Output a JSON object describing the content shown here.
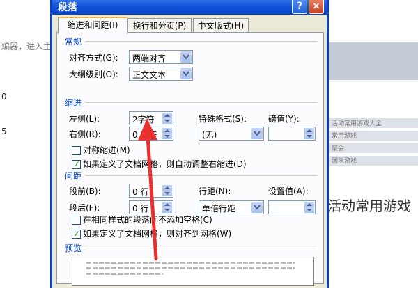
{
  "background": {
    "left_text": "編器，进入主",
    "right_title": "活动常用游戏",
    "right_items": [
      "活动常用游戏大全",
      "常用游戏",
      "聚会",
      "团队游戏"
    ]
  },
  "dialog": {
    "title": "段落",
    "help_label": "?",
    "close_label": "×",
    "tabs": [
      {
        "label": "缩进和间距(I)",
        "active": true
      },
      {
        "label": "换行和分页(P)",
        "active": false
      },
      {
        "label": "中文版式(H)",
        "active": false
      }
    ]
  },
  "general": {
    "heading": "常规",
    "alignment_label": "对齐方式(G):",
    "alignment_value": "两端对齐",
    "outline_label": "大纲级别(O):",
    "outline_value": "正文文本"
  },
  "indent": {
    "heading": "缩进",
    "left_label": "左侧(L):",
    "left_value": "2字符",
    "right_label": "右侧(R):",
    "right_value": "0 字符",
    "special_label": "特殊格式(S):",
    "special_value": "(无)",
    "by_label": "磅值(Y):",
    "by_value": "",
    "mirror_label": "对称缩进(M)",
    "mirror_checked": false,
    "auto_adjust_label": "如果定义了文档网格，则自动调整右缩进(D)",
    "auto_adjust_checked": true
  },
  "spacing": {
    "heading": "间距",
    "before_label": "段前(B):",
    "before_value": "0 行",
    "after_label": "段后(F):",
    "after_value": "0 行",
    "line_label": "行距(N):",
    "line_value": "单倍行距",
    "at_label": "设置值(A):",
    "at_value": "",
    "no_space_label": "在相同样式的段落间不添加空格(C)",
    "no_space_checked": false,
    "snap_grid_label": "如果定义了文档网格，则对齐到网格(W)",
    "snap_grid_checked": true
  },
  "preview": {
    "heading": "预览"
  },
  "colors": {
    "title_bar": "#0a45c8",
    "section_heading": "#0046d5",
    "annotation_arrow": "#e8312f"
  }
}
